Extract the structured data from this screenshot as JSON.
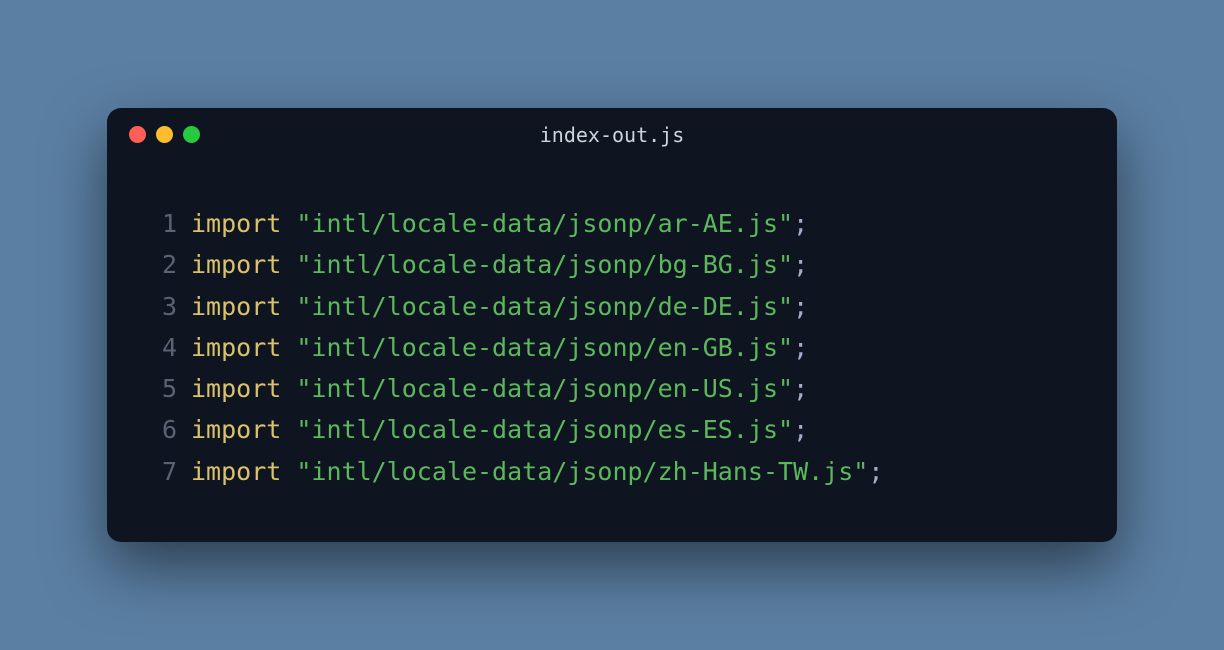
{
  "window": {
    "title": "index-out.js"
  },
  "code": {
    "keyword": "import",
    "lines": [
      {
        "num": "1",
        "str": "\"intl/locale-data/jsonp/ar-AE.js\""
      },
      {
        "num": "2",
        "str": "\"intl/locale-data/jsonp/bg-BG.js\""
      },
      {
        "num": "3",
        "str": "\"intl/locale-data/jsonp/de-DE.js\""
      },
      {
        "num": "4",
        "str": "\"intl/locale-data/jsonp/en-GB.js\""
      },
      {
        "num": "5",
        "str": "\"intl/locale-data/jsonp/en-US.js\""
      },
      {
        "num": "6",
        "str": "\"intl/locale-data/jsonp/es-ES.js\""
      },
      {
        "num": "7",
        "str": "\"intl/locale-data/jsonp/zh-Hans-TW.js\""
      }
    ]
  }
}
